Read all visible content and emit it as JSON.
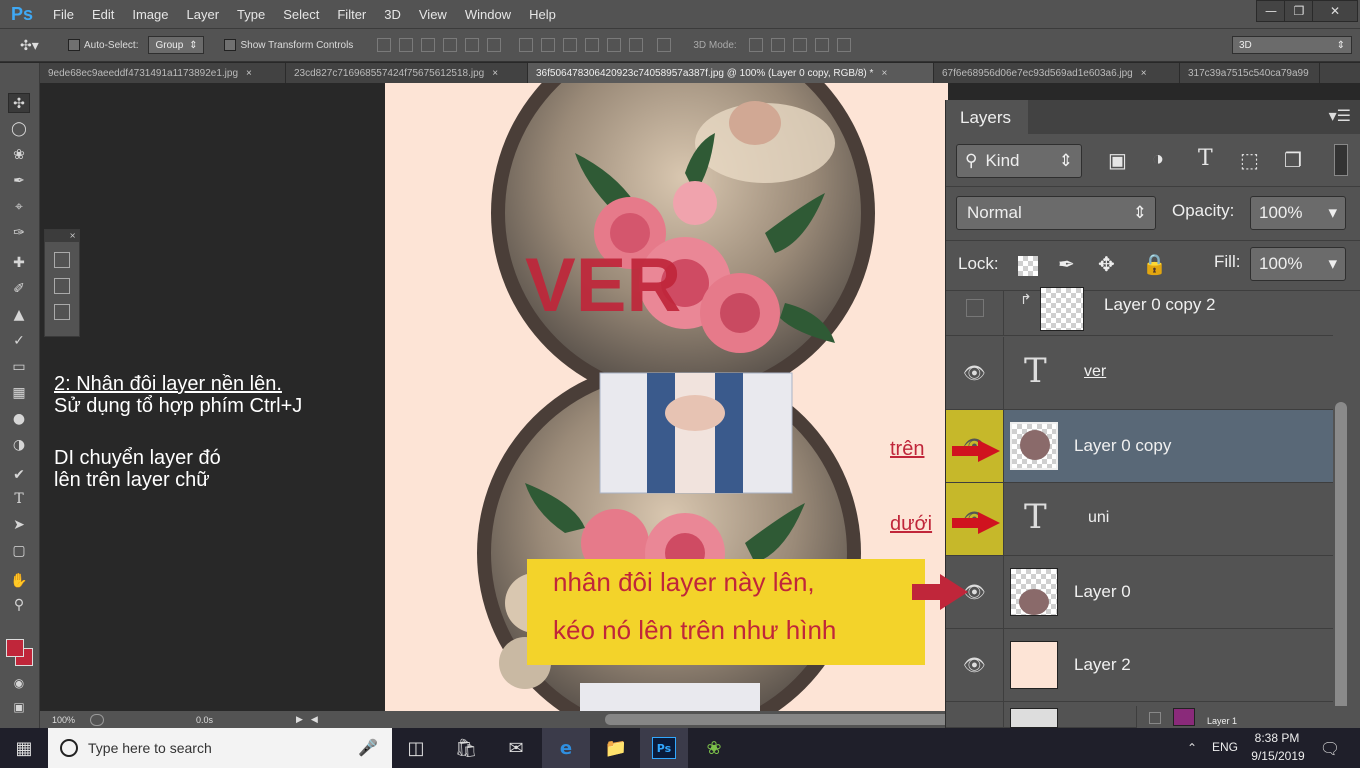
{
  "menubar": {
    "logo": "Ps",
    "items": [
      "File",
      "Edit",
      "Image",
      "Layer",
      "Type",
      "Select",
      "Filter",
      "3D",
      "View",
      "Window",
      "Help"
    ]
  },
  "options": {
    "auto_select_label": "Auto-Select:",
    "auto_select_value": "Group",
    "show_transform_label": "Show Transform Controls",
    "mode_3d_label": "3D Mode:",
    "workspace_value": "3D"
  },
  "tabs": [
    {
      "label": "9ede68ec9aeeddf4731491a1173892e1.jpg",
      "active": false
    },
    {
      "label": "23cd827c716968557424f75675612518.jpg",
      "active": false
    },
    {
      "label": "36f506478306420923c74058957a387f.jpg @ 100% (Layer 0 copy, RGB/8) *",
      "active": true
    },
    {
      "label": "67f6e68956d06e7ec93d569ad1e603a6.jpg",
      "active": false
    },
    {
      "label": "317c39a7515c540ca79a99",
      "active": false
    }
  ],
  "instructions": {
    "line1": "2: Nhân đôi layer nền lên.",
    "line2": "Sử dụng tổ hợp phím Ctrl+J",
    "line3": "DI chuyển layer đó",
    "line4": "lên trên layer chữ"
  },
  "canvas": {
    "text_art": "VER",
    "callout_line1": "nhân đôi layer này lên,",
    "callout_line2": "kéo nó lên trên như hình",
    "label_above": "trên",
    "label_below": "dưới"
  },
  "layers_panel": {
    "title": "Layers",
    "filter_label": "Kind",
    "blend_mode": "Normal",
    "opacity_label": "Opacity:",
    "opacity_value": "100%",
    "lock_label": "Lock:",
    "fill_label": "Fill:",
    "fill_value": "100%",
    "layers": [
      {
        "name": "Layer 0 copy 2",
        "kind": "image",
        "visible": false,
        "selected": false
      },
      {
        "name": "ver",
        "kind": "text",
        "visible": true,
        "selected": false
      },
      {
        "name": "Layer 0 copy",
        "kind": "image",
        "visible": true,
        "selected": true
      },
      {
        "name": "uni",
        "kind": "text",
        "visible": true,
        "selected": false
      },
      {
        "name": "Layer 0",
        "kind": "image",
        "visible": true,
        "selected": false
      },
      {
        "name": "Layer 2",
        "kind": "fill",
        "visible": true,
        "selected": false
      }
    ],
    "partial_layer": "Layer 1"
  },
  "status": {
    "zoom": "100%",
    "time": "0.0s"
  },
  "taskbar": {
    "search_placeholder": "Type here to search",
    "language": "ENG",
    "clock_time": "8:38 PM",
    "clock_date": "9/15/2019"
  },
  "colors": {
    "accent_red": "#c0263a",
    "callout_yellow": "#f3d32a",
    "highlight_olive": "#c6b82a",
    "selected_layer": "#596877"
  }
}
